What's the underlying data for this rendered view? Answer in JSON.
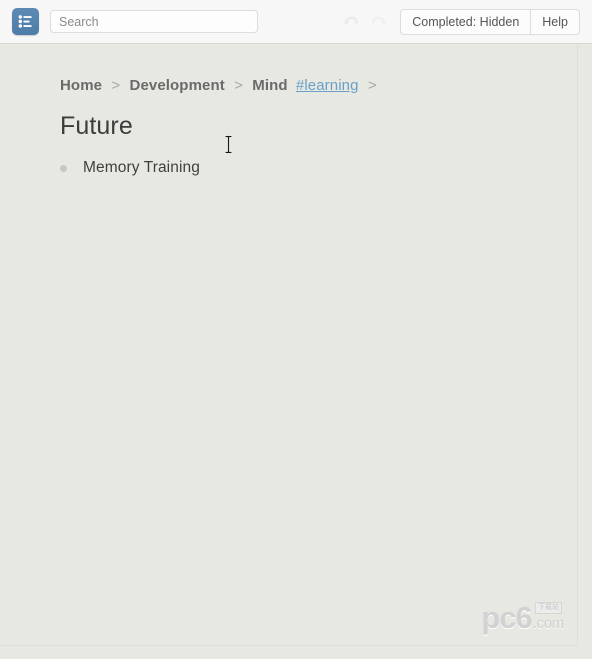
{
  "toolbar": {
    "app_icon": "list-menu-icon",
    "search": {
      "placeholder": "Search",
      "value": ""
    },
    "undo_icon": "undo-arrow-icon",
    "redo_icon": "redo-arrow-icon",
    "buttons": [
      {
        "label": "Completed: Hidden",
        "name": "completed-filter-button"
      },
      {
        "label": "Help",
        "name": "help-button"
      }
    ]
  },
  "breadcrumb": {
    "items": [
      {
        "label": "Home",
        "type": "link"
      },
      {
        "label": "Development",
        "type": "link"
      },
      {
        "label": "Mind",
        "type": "link"
      }
    ],
    "tag": "#learning",
    "separator": ">",
    "trailing_separator": ">"
  },
  "page": {
    "title": "Future",
    "items": [
      {
        "label": "Memory Training",
        "bullet": "dot"
      }
    ]
  },
  "watermark": {
    "text": "pc6",
    "suffix": ".com",
    "badge": "下载站"
  },
  "colors": {
    "background": "#e8e8e3",
    "toolbar_background": "#f7f7f7",
    "accent_blue": "#5b8bb5",
    "link_blue": "#6aa0c8",
    "text_dark": "#3c3c3c",
    "text_muted": "#6d6d6d",
    "bullet": "#c7c7c2"
  }
}
